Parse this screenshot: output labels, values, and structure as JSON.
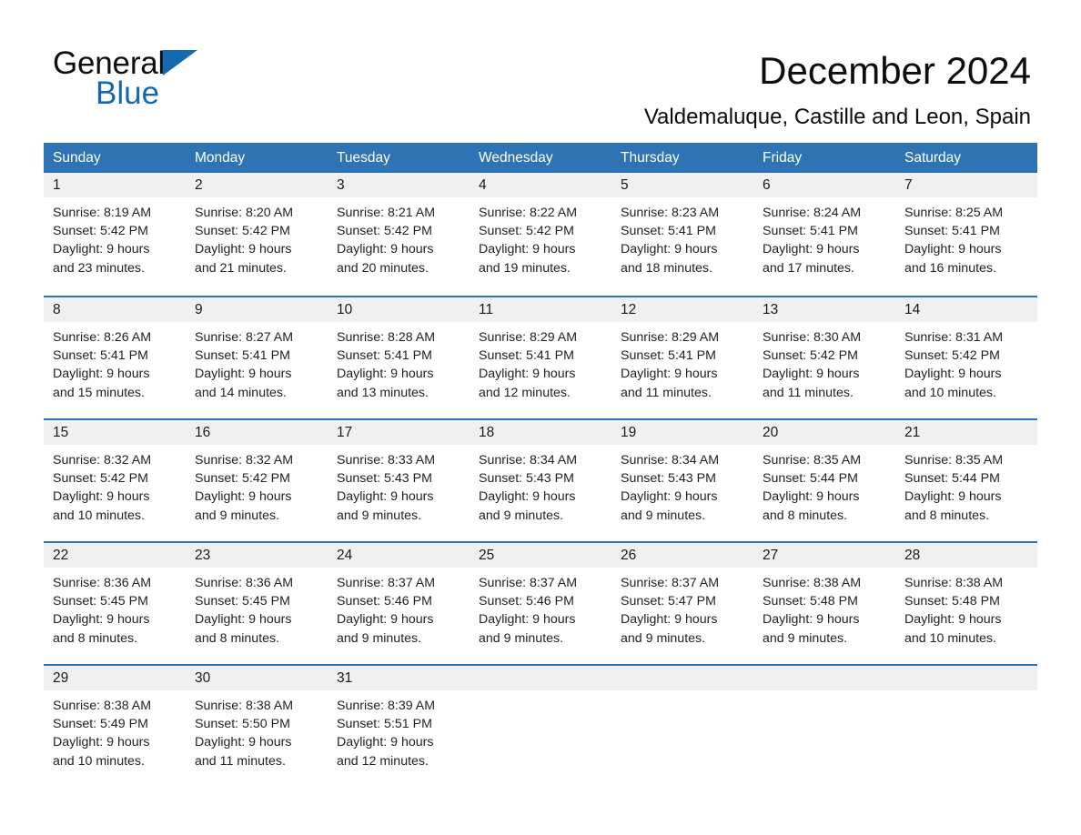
{
  "brand": {
    "word_general": "General",
    "word_blue": "Blue",
    "triangle_color": "#1569b0"
  },
  "header": {
    "month_title": "December 2024",
    "location": "Valdemaluque, Castille and Leon, Spain",
    "header_bg_color": "#2e74b5",
    "daynum_bg_color": "#f0f0f0"
  },
  "weekdays": [
    "Sunday",
    "Monday",
    "Tuesday",
    "Wednesday",
    "Thursday",
    "Friday",
    "Saturday"
  ],
  "weeks": [
    {
      "days": [
        {
          "num": "1",
          "sunrise": "Sunrise: 8:19 AM",
          "sunset": "Sunset: 5:42 PM",
          "daylight1": "Daylight: 9 hours",
          "daylight2": "and 23 minutes."
        },
        {
          "num": "2",
          "sunrise": "Sunrise: 8:20 AM",
          "sunset": "Sunset: 5:42 PM",
          "daylight1": "Daylight: 9 hours",
          "daylight2": "and 21 minutes."
        },
        {
          "num": "3",
          "sunrise": "Sunrise: 8:21 AM",
          "sunset": "Sunset: 5:42 PM",
          "daylight1": "Daylight: 9 hours",
          "daylight2": "and 20 minutes."
        },
        {
          "num": "4",
          "sunrise": "Sunrise: 8:22 AM",
          "sunset": "Sunset: 5:42 PM",
          "daylight1": "Daylight: 9 hours",
          "daylight2": "and 19 minutes."
        },
        {
          "num": "5",
          "sunrise": "Sunrise: 8:23 AM",
          "sunset": "Sunset: 5:41 PM",
          "daylight1": "Daylight: 9 hours",
          "daylight2": "and 18 minutes."
        },
        {
          "num": "6",
          "sunrise": "Sunrise: 8:24 AM",
          "sunset": "Sunset: 5:41 PM",
          "daylight1": "Daylight: 9 hours",
          "daylight2": "and 17 minutes."
        },
        {
          "num": "7",
          "sunrise": "Sunrise: 8:25 AM",
          "sunset": "Sunset: 5:41 PM",
          "daylight1": "Daylight: 9 hours",
          "daylight2": "and 16 minutes."
        }
      ]
    },
    {
      "days": [
        {
          "num": "8",
          "sunrise": "Sunrise: 8:26 AM",
          "sunset": "Sunset: 5:41 PM",
          "daylight1": "Daylight: 9 hours",
          "daylight2": "and 15 minutes."
        },
        {
          "num": "9",
          "sunrise": "Sunrise: 8:27 AM",
          "sunset": "Sunset: 5:41 PM",
          "daylight1": "Daylight: 9 hours",
          "daylight2": "and 14 minutes."
        },
        {
          "num": "10",
          "sunrise": "Sunrise: 8:28 AM",
          "sunset": "Sunset: 5:41 PM",
          "daylight1": "Daylight: 9 hours",
          "daylight2": "and 13 minutes."
        },
        {
          "num": "11",
          "sunrise": "Sunrise: 8:29 AM",
          "sunset": "Sunset: 5:41 PM",
          "daylight1": "Daylight: 9 hours",
          "daylight2": "and 12 minutes."
        },
        {
          "num": "12",
          "sunrise": "Sunrise: 8:29 AM",
          "sunset": "Sunset: 5:41 PM",
          "daylight1": "Daylight: 9 hours",
          "daylight2": "and 11 minutes."
        },
        {
          "num": "13",
          "sunrise": "Sunrise: 8:30 AM",
          "sunset": "Sunset: 5:42 PM",
          "daylight1": "Daylight: 9 hours",
          "daylight2": "and 11 minutes."
        },
        {
          "num": "14",
          "sunrise": "Sunrise: 8:31 AM",
          "sunset": "Sunset: 5:42 PM",
          "daylight1": "Daylight: 9 hours",
          "daylight2": "and 10 minutes."
        }
      ]
    },
    {
      "days": [
        {
          "num": "15",
          "sunrise": "Sunrise: 8:32 AM",
          "sunset": "Sunset: 5:42 PM",
          "daylight1": "Daylight: 9 hours",
          "daylight2": "and 10 minutes."
        },
        {
          "num": "16",
          "sunrise": "Sunrise: 8:32 AM",
          "sunset": "Sunset: 5:42 PM",
          "daylight1": "Daylight: 9 hours",
          "daylight2": "and 9 minutes."
        },
        {
          "num": "17",
          "sunrise": "Sunrise: 8:33 AM",
          "sunset": "Sunset: 5:43 PM",
          "daylight1": "Daylight: 9 hours",
          "daylight2": "and 9 minutes."
        },
        {
          "num": "18",
          "sunrise": "Sunrise: 8:34 AM",
          "sunset": "Sunset: 5:43 PM",
          "daylight1": "Daylight: 9 hours",
          "daylight2": "and 9 minutes."
        },
        {
          "num": "19",
          "sunrise": "Sunrise: 8:34 AM",
          "sunset": "Sunset: 5:43 PM",
          "daylight1": "Daylight: 9 hours",
          "daylight2": "and 9 minutes."
        },
        {
          "num": "20",
          "sunrise": "Sunrise: 8:35 AM",
          "sunset": "Sunset: 5:44 PM",
          "daylight1": "Daylight: 9 hours",
          "daylight2": "and 8 minutes."
        },
        {
          "num": "21",
          "sunrise": "Sunrise: 8:35 AM",
          "sunset": "Sunset: 5:44 PM",
          "daylight1": "Daylight: 9 hours",
          "daylight2": "and 8 minutes."
        }
      ]
    },
    {
      "days": [
        {
          "num": "22",
          "sunrise": "Sunrise: 8:36 AM",
          "sunset": "Sunset: 5:45 PM",
          "daylight1": "Daylight: 9 hours",
          "daylight2": "and 8 minutes."
        },
        {
          "num": "23",
          "sunrise": "Sunrise: 8:36 AM",
          "sunset": "Sunset: 5:45 PM",
          "daylight1": "Daylight: 9 hours",
          "daylight2": "and 8 minutes."
        },
        {
          "num": "24",
          "sunrise": "Sunrise: 8:37 AM",
          "sunset": "Sunset: 5:46 PM",
          "daylight1": "Daylight: 9 hours",
          "daylight2": "and 9 minutes."
        },
        {
          "num": "25",
          "sunrise": "Sunrise: 8:37 AM",
          "sunset": "Sunset: 5:46 PM",
          "daylight1": "Daylight: 9 hours",
          "daylight2": "and 9 minutes."
        },
        {
          "num": "26",
          "sunrise": "Sunrise: 8:37 AM",
          "sunset": "Sunset: 5:47 PM",
          "daylight1": "Daylight: 9 hours",
          "daylight2": "and 9 minutes."
        },
        {
          "num": "27",
          "sunrise": "Sunrise: 8:38 AM",
          "sunset": "Sunset: 5:48 PM",
          "daylight1": "Daylight: 9 hours",
          "daylight2": "and 9 minutes."
        },
        {
          "num": "28",
          "sunrise": "Sunrise: 8:38 AM",
          "sunset": "Sunset: 5:48 PM",
          "daylight1": "Daylight: 9 hours",
          "daylight2": "and 10 minutes."
        }
      ]
    },
    {
      "days": [
        {
          "num": "29",
          "sunrise": "Sunrise: 8:38 AM",
          "sunset": "Sunset: 5:49 PM",
          "daylight1": "Daylight: 9 hours",
          "daylight2": "and 10 minutes."
        },
        {
          "num": "30",
          "sunrise": "Sunrise: 8:38 AM",
          "sunset": "Sunset: 5:50 PM",
          "daylight1": "Daylight: 9 hours",
          "daylight2": "and 11 minutes."
        },
        {
          "num": "31",
          "sunrise": "Sunrise: 8:39 AM",
          "sunset": "Sunset: 5:51 PM",
          "daylight1": "Daylight: 9 hours",
          "daylight2": "and 12 minutes."
        },
        {
          "num": "",
          "sunrise": "",
          "sunset": "",
          "daylight1": "",
          "daylight2": ""
        },
        {
          "num": "",
          "sunrise": "",
          "sunset": "",
          "daylight1": "",
          "daylight2": ""
        },
        {
          "num": "",
          "sunrise": "",
          "sunset": "",
          "daylight1": "",
          "daylight2": ""
        },
        {
          "num": "",
          "sunrise": "",
          "sunset": "",
          "daylight1": "",
          "daylight2": ""
        }
      ]
    }
  ]
}
